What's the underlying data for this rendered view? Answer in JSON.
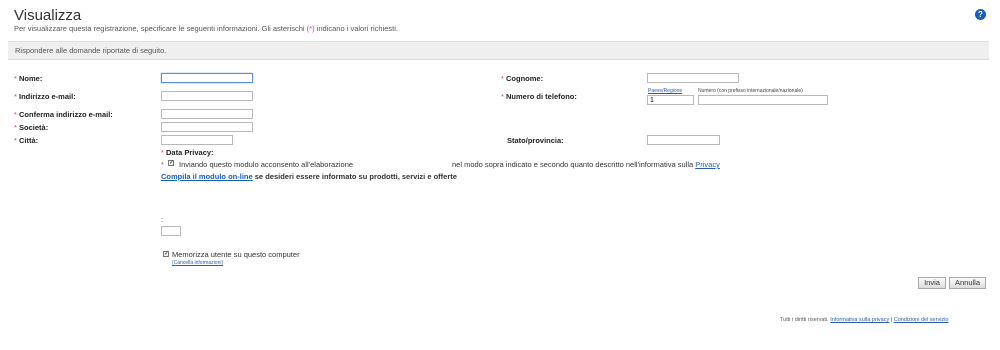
{
  "header": {
    "title": "Visualizza",
    "intro_before": "Per visualizzare questa registrazione, specificare le seguenti informazioni. Gli asterischi",
    "intro_marker": "(*)",
    "intro_after": "indicano i valori richiesti.",
    "help_icon": "?"
  },
  "instructions": "Rispondere alle domande riportate di seguito.",
  "form": {
    "required_mark": "*",
    "nome_label": "Nome:",
    "cognome_label": "Cognome:",
    "email_label": "Indirizzo e-mail:",
    "telefono_label": "Numero di telefono:",
    "paese_label": "Paese/Regione",
    "numero_label": "Numero (con prefisso internazionale/nazionale)",
    "country_code_value": "1",
    "conferma_email_label": "Conferma indirizzo e-mail:",
    "societa_label": "Società:",
    "citta_label": "Città:",
    "stato_label": "Stato/provincia:"
  },
  "privacy": {
    "title": "Data Privacy:",
    "consent_text_before": "Inviando questo modulo acconsento all'elaborazione",
    "consent_text_after": "nel modo sopra indicato e secondo quanto descritto nell'informativa sulla",
    "privacy_link": "Privacy",
    "online_form_link": "Compila il modulo on-line",
    "online_form_text": "se desideri essere informato su prodotti, servizi e offerte"
  },
  "extra_field_label": ":",
  "remember": {
    "label": "Memorizza utente su questo computer",
    "clear_link": "(Cancella informazioni)"
  },
  "buttons": {
    "submit": "Invia",
    "cancel": "Annulla"
  },
  "footer": {
    "rights": "Tutti i diritti riservati.",
    "privacy_link": "Informativa sulla privacy",
    "separator": "|",
    "terms_link": "Condizioni del servizio"
  }
}
